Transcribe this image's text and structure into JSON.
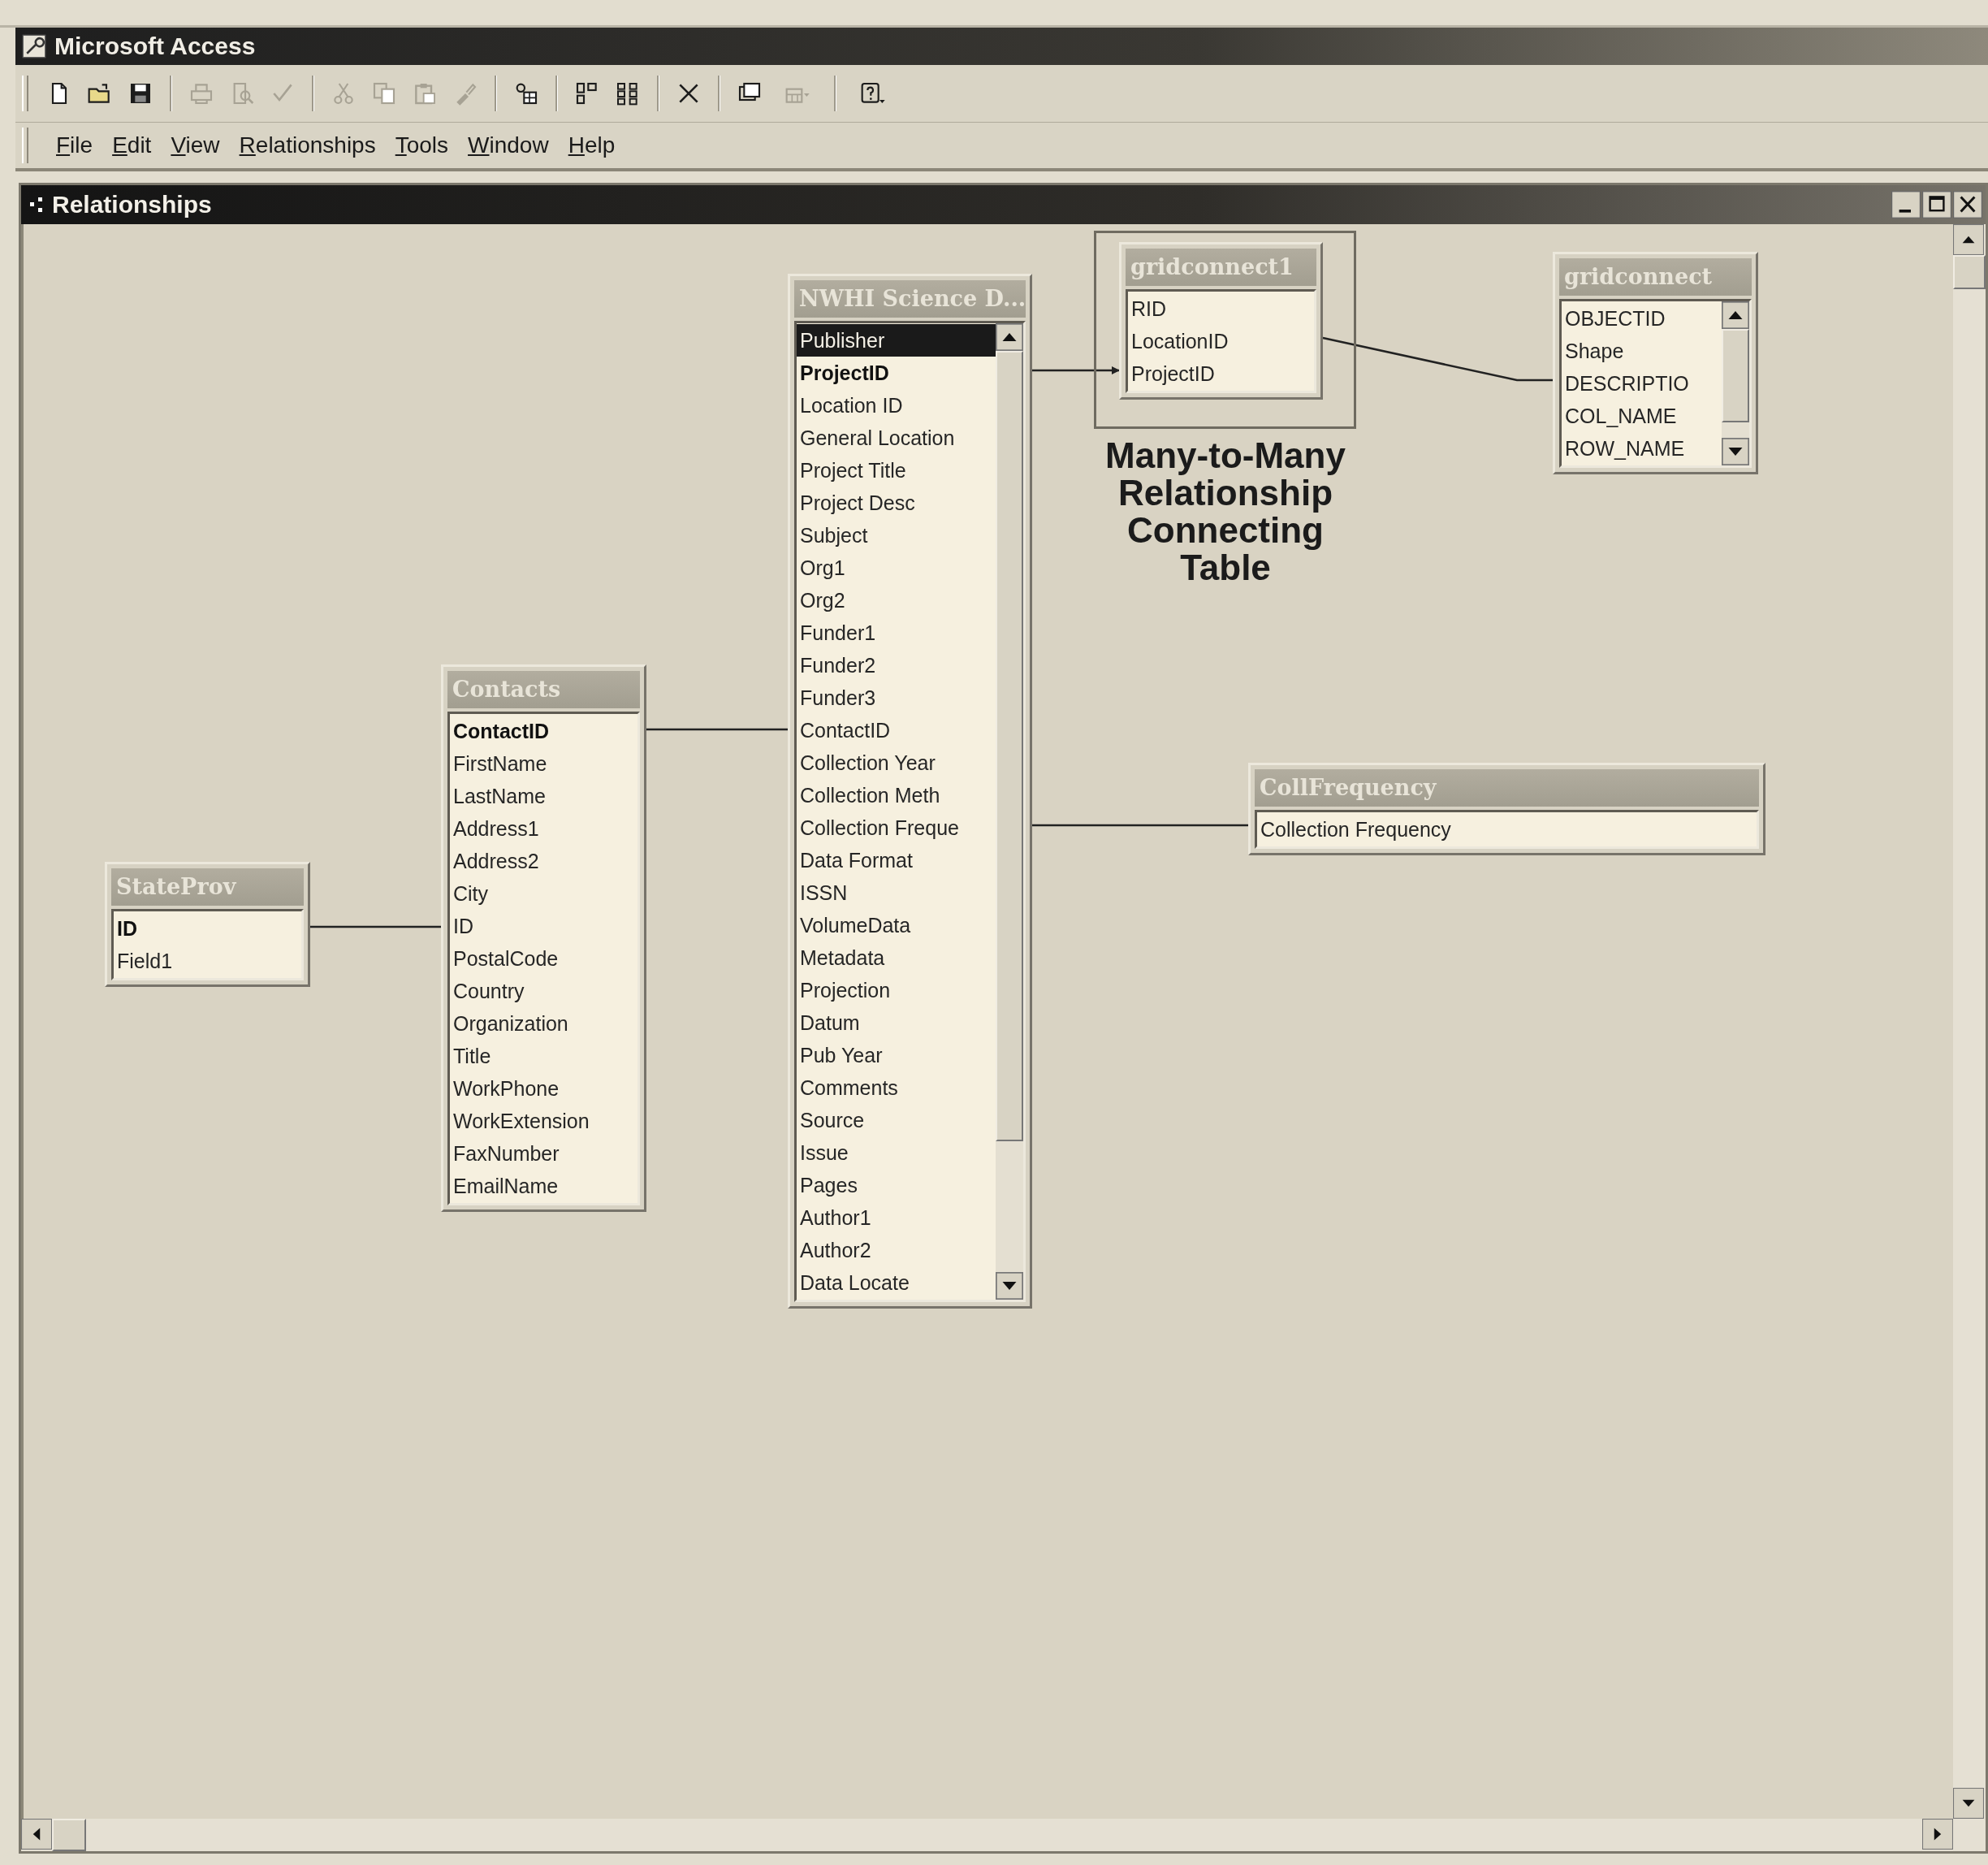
{
  "app": {
    "title": "Microsoft Access"
  },
  "toolbar": [
    {
      "kind": "new",
      "disabled": false
    },
    {
      "kind": "open",
      "disabled": false
    },
    {
      "kind": "save",
      "disabled": false
    },
    {
      "kind": "separator"
    },
    {
      "kind": "print",
      "disabled": true
    },
    {
      "kind": "preview",
      "disabled": true
    },
    {
      "kind": "spelling",
      "disabled": true
    },
    {
      "kind": "separator"
    },
    {
      "kind": "cut",
      "disabled": true
    },
    {
      "kind": "copy",
      "disabled": true
    },
    {
      "kind": "paste",
      "disabled": true
    },
    {
      "kind": "painter",
      "disabled": true
    },
    {
      "kind": "separator"
    },
    {
      "kind": "showtable",
      "disabled": false
    },
    {
      "kind": "separator"
    },
    {
      "kind": "direct",
      "disabled": false
    },
    {
      "kind": "all",
      "disabled": false
    },
    {
      "kind": "separator"
    },
    {
      "kind": "delete",
      "disabled": false
    },
    {
      "kind": "separator"
    },
    {
      "kind": "dbwindow",
      "disabled": false
    },
    {
      "kind": "newobject",
      "disabled": true
    },
    {
      "kind": "separator"
    },
    {
      "kind": "help",
      "disabled": false
    }
  ],
  "menu": [
    "File",
    "Edit",
    "View",
    "Relationships",
    "Tools",
    "Window",
    "Help"
  ],
  "window": {
    "title": "Relationships"
  },
  "tables": [
    {
      "title": "StateProv",
      "scrollable": false,
      "fields": [
        {
          "name": "ID",
          "key": true,
          "selected": false
        },
        {
          "name": "Field1",
          "key": false,
          "selected": false
        }
      ]
    },
    {
      "title": "Contacts",
      "scrollable": false,
      "fields": [
        {
          "name": "ContactID",
          "key": true,
          "selected": false
        },
        {
          "name": "FirstName",
          "key": false,
          "selected": false
        },
        {
          "name": "LastName",
          "key": false,
          "selected": false
        },
        {
          "name": "Address1",
          "key": false,
          "selected": false
        },
        {
          "name": "Address2",
          "key": false,
          "selected": false
        },
        {
          "name": "City",
          "key": false,
          "selected": false
        },
        {
          "name": "ID",
          "key": false,
          "selected": false
        },
        {
          "name": "PostalCode",
          "key": false,
          "selected": false
        },
        {
          "name": "Country",
          "key": false,
          "selected": false
        },
        {
          "name": "Organization",
          "key": false,
          "selected": false
        },
        {
          "name": "Title",
          "key": false,
          "selected": false
        },
        {
          "name": "WorkPhone",
          "key": false,
          "selected": false
        },
        {
          "name": "WorkExtension",
          "key": false,
          "selected": false
        },
        {
          "name": "FaxNumber",
          "key": false,
          "selected": false
        },
        {
          "name": "EmailName",
          "key": false,
          "selected": false
        }
      ]
    },
    {
      "title": "NWHI Science D...",
      "scrollable": true,
      "fields": [
        {
          "name": "Publisher",
          "key": false,
          "selected": true
        },
        {
          "name": "ProjectID",
          "key": true,
          "selected": false
        },
        {
          "name": "Location ID",
          "key": false,
          "selected": false
        },
        {
          "name": "General Location",
          "key": false,
          "selected": false
        },
        {
          "name": "Project Title",
          "key": false,
          "selected": false
        },
        {
          "name": "Project Desc",
          "key": false,
          "selected": false
        },
        {
          "name": "Subject",
          "key": false,
          "selected": false
        },
        {
          "name": "Org1",
          "key": false,
          "selected": false
        },
        {
          "name": "Org2",
          "key": false,
          "selected": false
        },
        {
          "name": "Funder1",
          "key": false,
          "selected": false
        },
        {
          "name": "Funder2",
          "key": false,
          "selected": false
        },
        {
          "name": "Funder3",
          "key": false,
          "selected": false
        },
        {
          "name": "ContactID",
          "key": false,
          "selected": false
        },
        {
          "name": "Collection Year",
          "key": false,
          "selected": false
        },
        {
          "name": "Collection Meth",
          "key": false,
          "selected": false
        },
        {
          "name": "Collection Freque",
          "key": false,
          "selected": false
        },
        {
          "name": "Data Format",
          "key": false,
          "selected": false
        },
        {
          "name": "ISSN",
          "key": false,
          "selected": false
        },
        {
          "name": "VolumeData",
          "key": false,
          "selected": false
        },
        {
          "name": "Metadata",
          "key": false,
          "selected": false
        },
        {
          "name": "Projection",
          "key": false,
          "selected": false
        },
        {
          "name": "Datum",
          "key": false,
          "selected": false
        },
        {
          "name": "Pub Year",
          "key": false,
          "selected": false
        },
        {
          "name": "Comments",
          "key": false,
          "selected": false
        },
        {
          "name": "Source",
          "key": false,
          "selected": false
        },
        {
          "name": "Issue",
          "key": false,
          "selected": false
        },
        {
          "name": "Pages",
          "key": false,
          "selected": false
        },
        {
          "name": "Author1",
          "key": false,
          "selected": false
        },
        {
          "name": "Author2",
          "key": false,
          "selected": false
        },
        {
          "name": "Data Locate",
          "key": false,
          "selected": false
        }
      ]
    },
    {
      "title": "gridconnect1",
      "scrollable": false,
      "fields": [
        {
          "name": "RID",
          "key": false,
          "selected": false
        },
        {
          "name": "LocationID",
          "key": false,
          "selected": false
        },
        {
          "name": "ProjectID",
          "key": false,
          "selected": false
        }
      ]
    },
    {
      "title": "gridconnect",
      "scrollable": true,
      "fields": [
        {
          "name": "OBJECTID",
          "key": false,
          "selected": false
        },
        {
          "name": "Shape",
          "key": false,
          "selected": false
        },
        {
          "name": "DESCRIPTIO",
          "key": false,
          "selected": false
        },
        {
          "name": "COL_NAME",
          "key": false,
          "selected": false
        },
        {
          "name": "ROW_NAME",
          "key": false,
          "selected": false
        }
      ]
    },
    {
      "title": "CollFrequency",
      "scrollable": false,
      "fields": [
        {
          "name": "Collection Frequency",
          "key": false,
          "selected": false
        }
      ]
    }
  ],
  "annotation": {
    "text": "Many-to-Many Relationship Connecting Table"
  }
}
